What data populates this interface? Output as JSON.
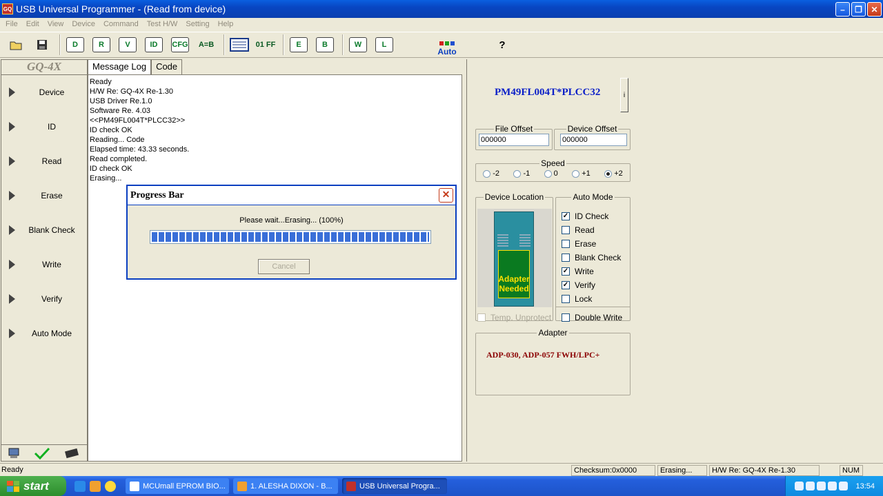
{
  "window": {
    "title": "USB Universal Programmer - (Read from device)",
    "icon_text": "GQ"
  },
  "menu": [
    "File",
    "Edit",
    "View",
    "Device",
    "Command",
    "Test H/W",
    "Setting",
    "Help"
  ],
  "toolbar": {
    "buttons": [
      "D",
      "R",
      "V",
      "ID",
      "CFG",
      "A=B",
      "01 FF",
      "E",
      "B",
      "W",
      "L"
    ],
    "auto_label": "Auto",
    "help_label": "?"
  },
  "sidebar": {
    "logo": "GQ-4X",
    "items": [
      "Device",
      "ID",
      "Read",
      "Erase",
      "Blank Check",
      "Write",
      "Verify",
      "Auto Mode"
    ]
  },
  "tabs": [
    "Message Log",
    "Code"
  ],
  "log": [
    "Ready",
    "H/W Re: GQ-4X Re-1.30",
    "USB Driver Re.1.0",
    "Software Re. 4.03",
    "<<PM49FL004T*PLCC32>>",
    "ID check OK",
    "Reading... Code",
    "Elapsed time: 43.33 seconds.",
    "Read completed.",
    "ID check OK",
    "Erasing..."
  ],
  "device": {
    "name": "PM49FL004T*PLCC32",
    "info_label": "i"
  },
  "offsets": {
    "file_label": "File Offset",
    "file_value": "000000",
    "device_label": "Device Offset",
    "device_value": "000000"
  },
  "speed": {
    "label": "Speed",
    "options": [
      "-2",
      "-1",
      "0",
      "+1",
      "+2"
    ],
    "selected": "+2"
  },
  "device_location": {
    "label": "Device Location",
    "adapter_line1": "Adapter",
    "adapter_line2": "Needed",
    "temp_unprotect": "Temp. Unprotect"
  },
  "auto_mode": {
    "label": "Auto Mode",
    "items": [
      {
        "label": "ID Check",
        "checked": true
      },
      {
        "label": "Read",
        "checked": false
      },
      {
        "label": "Erase",
        "checked": false
      },
      {
        "label": "Blank Check",
        "checked": false
      },
      {
        "label": "Write",
        "checked": true
      },
      {
        "label": "Verify",
        "checked": true
      },
      {
        "label": "Lock",
        "checked": false
      }
    ],
    "double_write": "Double Write"
  },
  "adapter": {
    "label": "Adapter",
    "value": "ADP-030, ADP-057 FWH/LPC+"
  },
  "dialog": {
    "title": "Progress Bar",
    "message": "Please wait...Erasing... (100%)",
    "progress": 1.0,
    "cancel_label": "Cancel"
  },
  "status": {
    "left": "Ready",
    "checksum": "Checksum:0x0000",
    "state": "Erasing...",
    "hw": "H/W Re: GQ-4X Re-1.30",
    "num": "NUM"
  },
  "taskbar": {
    "start": "start",
    "tasks": [
      "MCUmall EPROM BIO...",
      "1. ALESHA DIXON - B...",
      "USB Universal Progra..."
    ],
    "clock": "13:54"
  },
  "colors": {
    "device_name": "#0a1ec8",
    "adapter_text": "#8b0000",
    "titlebar": "#0846c2"
  }
}
